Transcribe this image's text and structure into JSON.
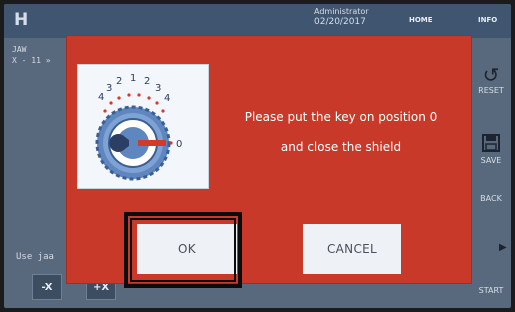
{
  "topbar": {
    "logo": "H",
    "user_name": "Administrator",
    "date": "02/20/2017",
    "home_label": "HOME",
    "info_label": "INFO"
  },
  "console": {
    "line1": "JAW",
    "line2": "X - 11 »"
  },
  "hint_text": "Use jaa",
  "jog": {
    "minus_label": "-X",
    "plus_label": "+X"
  },
  "side_buttons": {
    "reset_label": "RESET",
    "save_label": "SAVE",
    "back_label": "BACK",
    "start_label": "START"
  },
  "dialog": {
    "dial_numbers": [
      "4",
      "3",
      "2",
      "1",
      "2",
      "3",
      "4"
    ],
    "dial_zero": "0",
    "message_line1": "Please put the key on position 0",
    "message_line2": "and close the shield",
    "ok_label": "OK",
    "cancel_label": "CANCEL"
  },
  "colors": {
    "dialog_bg": "#c8392a",
    "screen_bg": "#59697d",
    "button_bg": "#eef1f6",
    "dial_blue": "#5f86bf"
  },
  "icons": {
    "reset": "rotate-ccw-icon",
    "save": "floppy-disk-icon",
    "next": "chevron-right-icon"
  }
}
